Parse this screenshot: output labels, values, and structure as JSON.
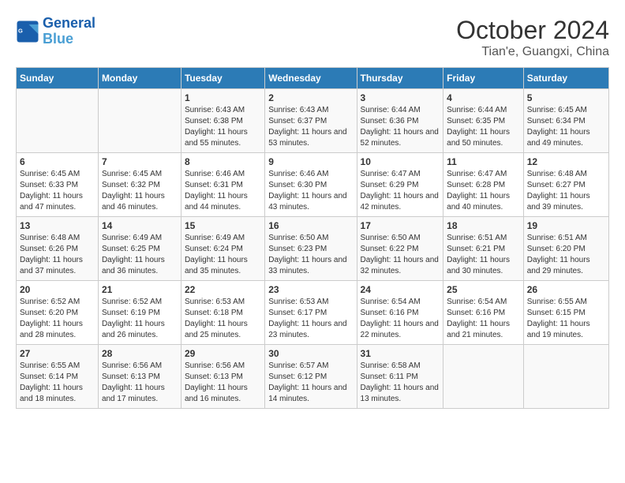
{
  "header": {
    "logo_line1": "General",
    "logo_line2": "Blue",
    "title": "October 2024",
    "subtitle": "Tian'e, Guangxi, China"
  },
  "columns": [
    "Sunday",
    "Monday",
    "Tuesday",
    "Wednesday",
    "Thursday",
    "Friday",
    "Saturday"
  ],
  "weeks": [
    [
      {
        "day": "",
        "info": ""
      },
      {
        "day": "",
        "info": ""
      },
      {
        "day": "1",
        "info": "Sunrise: 6:43 AM\nSunset: 6:38 PM\nDaylight: 11 hours and 55 minutes."
      },
      {
        "day": "2",
        "info": "Sunrise: 6:43 AM\nSunset: 6:37 PM\nDaylight: 11 hours and 53 minutes."
      },
      {
        "day": "3",
        "info": "Sunrise: 6:44 AM\nSunset: 6:36 PM\nDaylight: 11 hours and 52 minutes."
      },
      {
        "day": "4",
        "info": "Sunrise: 6:44 AM\nSunset: 6:35 PM\nDaylight: 11 hours and 50 minutes."
      },
      {
        "day": "5",
        "info": "Sunrise: 6:45 AM\nSunset: 6:34 PM\nDaylight: 11 hours and 49 minutes."
      }
    ],
    [
      {
        "day": "6",
        "info": "Sunrise: 6:45 AM\nSunset: 6:33 PM\nDaylight: 11 hours and 47 minutes."
      },
      {
        "day": "7",
        "info": "Sunrise: 6:45 AM\nSunset: 6:32 PM\nDaylight: 11 hours and 46 minutes."
      },
      {
        "day": "8",
        "info": "Sunrise: 6:46 AM\nSunset: 6:31 PM\nDaylight: 11 hours and 44 minutes."
      },
      {
        "day": "9",
        "info": "Sunrise: 6:46 AM\nSunset: 6:30 PM\nDaylight: 11 hours and 43 minutes."
      },
      {
        "day": "10",
        "info": "Sunrise: 6:47 AM\nSunset: 6:29 PM\nDaylight: 11 hours and 42 minutes."
      },
      {
        "day": "11",
        "info": "Sunrise: 6:47 AM\nSunset: 6:28 PM\nDaylight: 11 hours and 40 minutes."
      },
      {
        "day": "12",
        "info": "Sunrise: 6:48 AM\nSunset: 6:27 PM\nDaylight: 11 hours and 39 minutes."
      }
    ],
    [
      {
        "day": "13",
        "info": "Sunrise: 6:48 AM\nSunset: 6:26 PM\nDaylight: 11 hours and 37 minutes."
      },
      {
        "day": "14",
        "info": "Sunrise: 6:49 AM\nSunset: 6:25 PM\nDaylight: 11 hours and 36 minutes."
      },
      {
        "day": "15",
        "info": "Sunrise: 6:49 AM\nSunset: 6:24 PM\nDaylight: 11 hours and 35 minutes."
      },
      {
        "day": "16",
        "info": "Sunrise: 6:50 AM\nSunset: 6:23 PM\nDaylight: 11 hours and 33 minutes."
      },
      {
        "day": "17",
        "info": "Sunrise: 6:50 AM\nSunset: 6:22 PM\nDaylight: 11 hours and 32 minutes."
      },
      {
        "day": "18",
        "info": "Sunrise: 6:51 AM\nSunset: 6:21 PM\nDaylight: 11 hours and 30 minutes."
      },
      {
        "day": "19",
        "info": "Sunrise: 6:51 AM\nSunset: 6:20 PM\nDaylight: 11 hours and 29 minutes."
      }
    ],
    [
      {
        "day": "20",
        "info": "Sunrise: 6:52 AM\nSunset: 6:20 PM\nDaylight: 11 hours and 28 minutes."
      },
      {
        "day": "21",
        "info": "Sunrise: 6:52 AM\nSunset: 6:19 PM\nDaylight: 11 hours and 26 minutes."
      },
      {
        "day": "22",
        "info": "Sunrise: 6:53 AM\nSunset: 6:18 PM\nDaylight: 11 hours and 25 minutes."
      },
      {
        "day": "23",
        "info": "Sunrise: 6:53 AM\nSunset: 6:17 PM\nDaylight: 11 hours and 23 minutes."
      },
      {
        "day": "24",
        "info": "Sunrise: 6:54 AM\nSunset: 6:16 PM\nDaylight: 11 hours and 22 minutes."
      },
      {
        "day": "25",
        "info": "Sunrise: 6:54 AM\nSunset: 6:16 PM\nDaylight: 11 hours and 21 minutes."
      },
      {
        "day": "26",
        "info": "Sunrise: 6:55 AM\nSunset: 6:15 PM\nDaylight: 11 hours and 19 minutes."
      }
    ],
    [
      {
        "day": "27",
        "info": "Sunrise: 6:55 AM\nSunset: 6:14 PM\nDaylight: 11 hours and 18 minutes."
      },
      {
        "day": "28",
        "info": "Sunrise: 6:56 AM\nSunset: 6:13 PM\nDaylight: 11 hours and 17 minutes."
      },
      {
        "day": "29",
        "info": "Sunrise: 6:56 AM\nSunset: 6:13 PM\nDaylight: 11 hours and 16 minutes."
      },
      {
        "day": "30",
        "info": "Sunrise: 6:57 AM\nSunset: 6:12 PM\nDaylight: 11 hours and 14 minutes."
      },
      {
        "day": "31",
        "info": "Sunrise: 6:58 AM\nSunset: 6:11 PM\nDaylight: 11 hours and 13 minutes."
      },
      {
        "day": "",
        "info": ""
      },
      {
        "day": "",
        "info": ""
      }
    ]
  ]
}
